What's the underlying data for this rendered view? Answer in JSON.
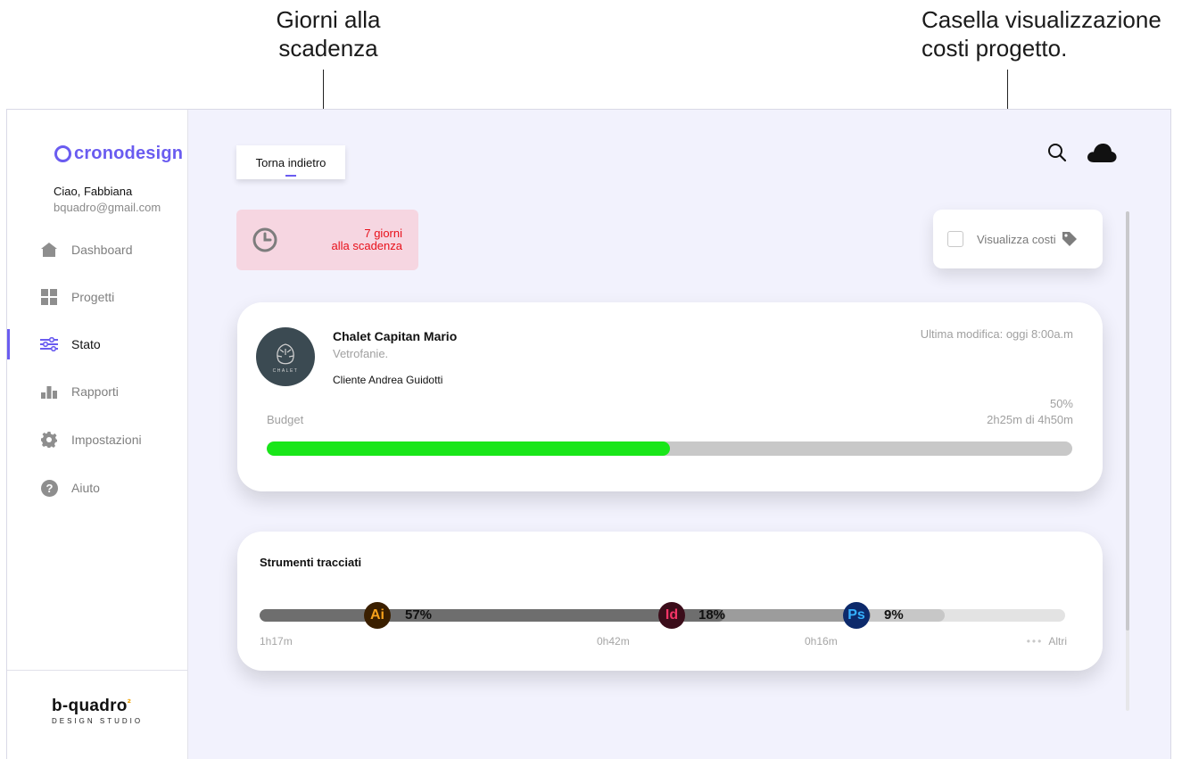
{
  "annotations": {
    "deadline_note": "Giorni alla scadenza",
    "costs_note": "Casella visualizzazione costi progetto."
  },
  "sidebar": {
    "app_name": "cronodesign",
    "logo_initial": "c",
    "greeting": "Ciao, Fabbiana",
    "email": "bquadro@gmail.com",
    "items": [
      {
        "label": "Dashboard",
        "icon": "home-icon"
      },
      {
        "label": "Progetti",
        "icon": "grid-icon"
      },
      {
        "label": "Stato",
        "icon": "sliders-icon",
        "active": true
      },
      {
        "label": "Rapporti",
        "icon": "bar-chart-icon"
      },
      {
        "label": "Impostazioni",
        "icon": "gear-icon"
      },
      {
        "label": "Aiuto",
        "icon": "help-icon"
      }
    ],
    "brand_name": "b-quadro",
    "brand_sub": "DESIGN STUDIO"
  },
  "header": {
    "back_label": "Torna indietro",
    "icons": [
      "search-icon",
      "cloud-icon"
    ]
  },
  "deadline": {
    "line1": "7 giorni",
    "line2": "alla scadenza",
    "color": "#e8101a",
    "bg": "#f6d6e1"
  },
  "costs": {
    "label": "Visualizza costi",
    "checked": false,
    "icon": "tag-icon"
  },
  "project": {
    "title": "Chalet Capitan Mario",
    "subtitle": "Vetrofanie.",
    "client": "Cliente Andrea Guidotti",
    "last_modified": "Ultima modifica: oggi 8:00a.m",
    "budget_label": "Budget",
    "percent": "50%",
    "time": "2h25m di 4h50m",
    "progress": 0.5,
    "progress_color": "#19e619",
    "avatar_text": "CHALET"
  },
  "tools": {
    "title": "Strumenti tracciati",
    "items": [
      {
        "abbr": "Ai",
        "percent": "57%",
        "time": "1h17m",
        "badge_bg": "#3a1f00",
        "badge_fg": "#f7a21b",
        "seg_color": "#6e6e6e"
      },
      {
        "abbr": "Id",
        "percent": "18%",
        "time": "0h42m",
        "badge_bg": "#3b0d1a",
        "badge_fg": "#f43567",
        "seg_color": "#9c9c9c"
      },
      {
        "abbr": "Ps",
        "percent": "9%",
        "time": "0h16m",
        "badge_bg": "#0d2a6b",
        "badge_fg": "#35b1ff",
        "seg_color": "#c7c7c7"
      }
    ],
    "other_label": "Altri",
    "other_dots": "•••"
  },
  "colors": {
    "accent": "#6a5cf0",
    "background": "#f2f2fd"
  }
}
